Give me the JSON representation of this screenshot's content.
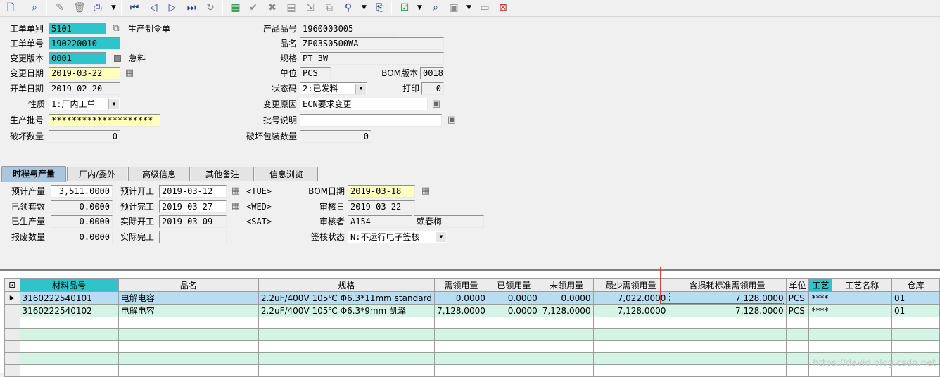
{
  "toolbar": {
    "buttons": [
      {
        "name": "new-doc-icon",
        "glyph": "🗋"
      },
      {
        "name": "find-icon",
        "glyph": "🔍"
      },
      {
        "name": "edit-icon",
        "glyph": "✎"
      },
      {
        "name": "delete-icon",
        "glyph": "🗑"
      },
      {
        "name": "print-icon",
        "glyph": "🖶"
      },
      {
        "name": "first-record-icon",
        "glyph": "⏮"
      },
      {
        "name": "prev-record-icon",
        "glyph": "◀"
      },
      {
        "name": "next-record-icon",
        "glyph": "▶"
      },
      {
        "name": "last-record-icon",
        "glyph": "⏭"
      },
      {
        "name": "refresh-icon",
        "glyph": "↻"
      },
      {
        "name": "calculator-icon",
        "glyph": "▦"
      },
      {
        "name": "confirm-check-icon",
        "glyph": "✔"
      },
      {
        "name": "cancel-x-icon",
        "glyph": "✖"
      },
      {
        "name": "form-icon",
        "glyph": "▤"
      },
      {
        "name": "export-icon",
        "glyph": "⇲"
      },
      {
        "name": "query-icon",
        "glyph": "⚲"
      },
      {
        "name": "attach-icon",
        "glyph": "⎘"
      },
      {
        "name": "checklist-icon",
        "glyph": "☑"
      },
      {
        "name": "preview-icon",
        "glyph": "⌕"
      },
      {
        "name": "report-icon",
        "glyph": "▣"
      },
      {
        "name": "folder-icon",
        "glyph": "▭"
      },
      {
        "name": "exit-icon",
        "glyph": "⊠"
      }
    ]
  },
  "header": {
    "order_type_label": "工单单别",
    "order_type_value": "5101",
    "order_type_name": "生产制令单",
    "order_no_label": "工单单号",
    "order_no_value": "190220010",
    "change_version_label": "变更版本",
    "change_version_value": "0001",
    "urgent_label": "急料",
    "change_date_label": "变更日期",
    "change_date_value": "2019-03-22",
    "open_date_label": "开单日期",
    "open_date_value": "2019-02-20",
    "nature_label": "性质",
    "nature_value": "1:厂内工单",
    "batch_no_label": "生产批号",
    "batch_no_value": "********************",
    "damage_qty_label": "破坏数量",
    "damage_qty_value": "0",
    "product_no_label": "产品品号",
    "product_no_value": "1960003005",
    "product_name_label": "品名",
    "product_name_value": "ZP03S0500WA",
    "spec_label": "规格",
    "spec_value": "PT 3W",
    "unit_label": "单位",
    "unit_value": "PCS",
    "bom_version_label": "BOM版本",
    "bom_version_value": "0018",
    "status_label": "状态码",
    "status_value": "2:已发料",
    "print_label": "打印",
    "print_value": "0",
    "change_reason_label": "变更原因",
    "change_reason_value": "ECN要求变更",
    "batch_desc_label": "批号说明",
    "batch_desc_value": "",
    "damage_pack_label": "破坏包装数量",
    "damage_pack_value": "0"
  },
  "tabs": [
    {
      "label": "时程与产量",
      "active": true
    },
    {
      "label": "厂内/委外",
      "active": false
    },
    {
      "label": "高级信息",
      "active": false
    },
    {
      "label": "其他备注",
      "active": false
    },
    {
      "label": "信息浏览",
      "active": false
    }
  ],
  "schedule": {
    "planned_qty_label": "预计产量",
    "planned_qty_value": "3,511.0000",
    "received_sets_label": "已领套数",
    "received_sets_value": "0.0000",
    "produced_label": "已生产量",
    "produced_value": "0.0000",
    "scrap_label": "报废数量",
    "scrap_value": "0.0000",
    "plan_start_label": "预计开工",
    "plan_start_value": "2019-03-12",
    "plan_start_day": "<TUE>",
    "plan_end_label": "预计完工",
    "plan_end_value": "2019-03-27",
    "plan_end_day": "<WED>",
    "actual_start_label": "实际开工",
    "actual_start_value": "2019-03-09",
    "actual_start_day": "<SAT>",
    "actual_end_label": "实际完工",
    "actual_end_value": "",
    "bom_date_label": "BOM日期",
    "bom_date_value": "2019-03-18",
    "review_date_label": "审核日",
    "review_date_value": "2019-03-22",
    "reviewer_label": "审核者",
    "reviewer_code": "A154",
    "reviewer_name": "赖春梅",
    "sign_status_label": "签核状态",
    "sign_status_value": "N:不运行电子签核"
  },
  "grid": {
    "columns": [
      "材料品号",
      "品名",
      "规格",
      "需领用量",
      "已领用量",
      "未领用量",
      "最少需领用量",
      "含损耗标准需领用量",
      "单位",
      "工艺",
      "工艺名称",
      "仓库"
    ],
    "rows": [
      [
        "3160222540101",
        "电解电容",
        "2.2uF/400V 105℃ Φ6.3*11mm standard",
        "0.0000",
        "0.0000",
        "0.0000",
        "7,022.0000",
        "7,128.0000",
        "PCS",
        "****",
        "",
        "01"
      ],
      [
        "3160222540102",
        "电解电容",
        "2.2uF/400V 105℃ Φ6.3*9mm 凯泽",
        "7,128.0000",
        "0.0000",
        "7,128.0000",
        "7,128.0000",
        "7,128.0000",
        "PCS",
        "****",
        "",
        "01"
      ]
    ],
    "current_row_marker": "▶"
  },
  "watermark": "https://david.blog.csdn.net",
  "colors": {
    "required_field": "#2fc4c9",
    "date_field": "#ffffc0",
    "selected_row": "#b8dcf0",
    "alt_row": "#d4f4e6",
    "active_tab": "#a9c6de",
    "annotation_box": "#e03c3c"
  }
}
